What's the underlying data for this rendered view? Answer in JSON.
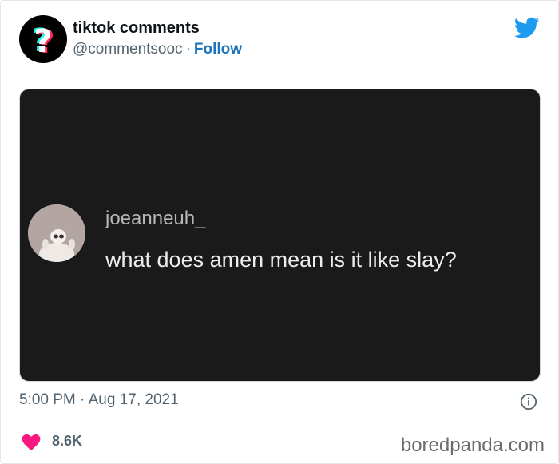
{
  "tweet": {
    "display_name": "tiktok comments",
    "handle": "@commentsooc",
    "separator": "·",
    "follow_label": "Follow",
    "timestamp": "5:00 PM · Aug 17, 2021",
    "like_count": "8.6K"
  },
  "media": {
    "comment_username": "joeanneuh_",
    "comment_text": "what does amen mean is it like slay?"
  },
  "watermark": "boredpanda.com",
  "colors": {
    "twitter_blue": "#1d9bf0",
    "like_red": "#f91880",
    "follow_blue": "#1b74bb"
  },
  "icons": {
    "brand": "twitter-bird-icon",
    "avatar": "question-mark-logo",
    "info": "info-icon",
    "like": "heart-icon"
  }
}
